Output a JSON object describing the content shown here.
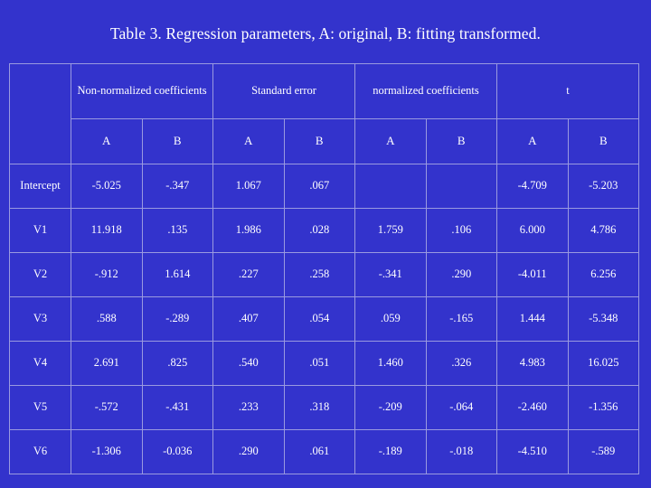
{
  "title": "Table 3. Regression parameters, A: original, B: fitting transformed.",
  "colors": {
    "background": "#3333cc",
    "gridline": "#9a9ae0",
    "text": "#ffffff"
  },
  "table": {
    "corner_label": "",
    "group_headers": [
      "Non-normalized coefficients",
      "Standard error",
      "normalized coefficients",
      "t"
    ],
    "sub_headers": [
      "A",
      "B",
      "A",
      "B",
      "A",
      "B",
      "A",
      "B"
    ],
    "rows": [
      {
        "label": "Intercept",
        "values": [
          "-5.025",
          "-.347",
          "1.067",
          ".067",
          "",
          "",
          "-4.709",
          "-5.203"
        ]
      },
      {
        "label": "V1",
        "values": [
          "11.918",
          ".135",
          "1.986",
          ".028",
          "1.759",
          ".106",
          "6.000",
          "4.786"
        ]
      },
      {
        "label": "V2",
        "values": [
          "-.912",
          "1.614",
          ".227",
          ".258",
          "-.341",
          ".290",
          "-4.011",
          "6.256"
        ]
      },
      {
        "label": "V3",
        "values": [
          ".588",
          "-.289",
          ".407",
          ".054",
          ".059",
          "-.165",
          "1.444",
          "-5.348"
        ]
      },
      {
        "label": "V4",
        "values": [
          "2.691",
          ".825",
          ".540",
          ".051",
          "1.460",
          ".326",
          "4.983",
          "16.025"
        ]
      },
      {
        "label": "V5",
        "values": [
          "-.572",
          "-.431",
          ".233",
          ".318",
          "-.209",
          "-.064",
          "-2.460",
          "-1.356"
        ]
      },
      {
        "label": "V6",
        "values": [
          "-1.306",
          "-0.036",
          ".290",
          ".061",
          "-.189",
          "-.018",
          "-4.510",
          "-.589"
        ]
      }
    ]
  }
}
